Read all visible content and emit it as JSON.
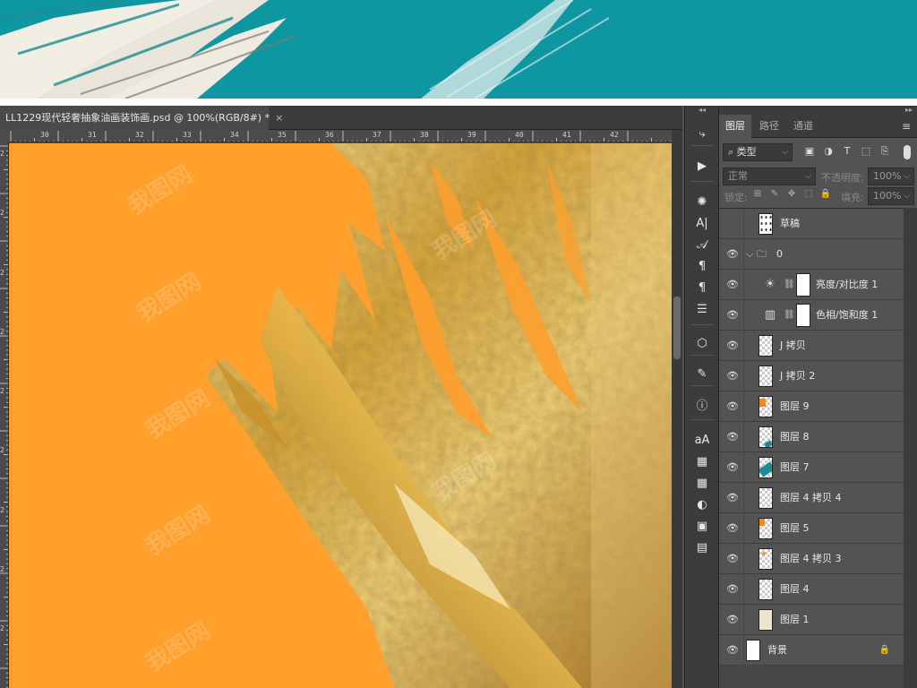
{
  "document": {
    "tab_title": "LL1229现代轻奢抽象油画装饰画.psd @ 100%(RGB/8#) *",
    "close_glyph": "×"
  },
  "ruler": {
    "h_labels": [
      "30",
      "31",
      "32",
      "33",
      "34",
      "35",
      "36",
      "37",
      "38",
      "39",
      "40",
      "41",
      "42"
    ],
    "v_labels": [
      "2",
      "2",
      "2",
      "2",
      "2",
      "2",
      "2",
      "2",
      "2"
    ],
    "corner_mark": "|"
  },
  "toolbar": {
    "collapse_glyph": "◂◂",
    "tools": [
      {
        "icon": "history-brush-icon",
        "glyph": "⤷"
      },
      {
        "icon": "play-icon",
        "glyph": "▶"
      },
      {
        "icon": "palette-icon",
        "glyph": "✺"
      },
      {
        "icon": "character-icon",
        "glyph": "A|"
      },
      {
        "icon": "glyph-icon",
        "glyph": "𝒜"
      },
      {
        "icon": "paragraph-styles-icon",
        "glyph": "¶"
      },
      {
        "icon": "paragraph-icon",
        "glyph": "¶"
      },
      {
        "icon": "properties-sliders-icon",
        "glyph": "☰"
      },
      {
        "icon": "3d-cube-icon",
        "glyph": "⬡"
      },
      {
        "icon": "brush-settings-icon",
        "glyph": "✎"
      },
      {
        "icon": "info-icon",
        "glyph": "ⓘ"
      },
      {
        "icon": "character-styles-icon",
        "glyph": "aA"
      },
      {
        "icon": "libraries-icon",
        "glyph": "▦"
      },
      {
        "icon": "swatches-icon",
        "glyph": "▦"
      },
      {
        "icon": "adjustments-icon",
        "glyph": "◐"
      },
      {
        "icon": "layer-comps-icon",
        "glyph": "▣"
      },
      {
        "icon": "notes-icon",
        "glyph": "▤"
      }
    ]
  },
  "panel": {
    "expand_glyph": "▸▸",
    "tabs": [
      "图层",
      "路径",
      "通道"
    ],
    "active_tab": "图层",
    "menu_glyph": "≡",
    "filter_label": "类型",
    "filter_icons": [
      "image-filter-icon",
      "adjustment-filter-icon",
      "type-filter-icon",
      "shape-filter-icon",
      "smart-object-filter-icon"
    ],
    "filter_glyphs": [
      "▣",
      "◑",
      "T",
      "⬚",
      "⎘"
    ],
    "blend_mode": "正常",
    "opacity_label": "不透明度:",
    "opacity_value": "100%",
    "lock_label": "锁定:",
    "lock_glyphs": [
      "⊞",
      "✎",
      "✥",
      "⬚",
      "🔒"
    ],
    "fill_label": "填充:",
    "fill_value": "100%",
    "search_glyph": "⌕",
    "caret_glyph": "⌵",
    "eye_glyph": "👁",
    "chain_glyph": "⛓",
    "group_caret_glyph": "⌵",
    "folder_glyph": "🗀",
    "lock_icon_glyph": "🔒",
    "layers": [
      {
        "name": "草稿",
        "visible": false,
        "kind": "pixel",
        "thumb": "sketch"
      },
      {
        "name": "0",
        "visible": true,
        "kind": "group"
      },
      {
        "name": "亮度/对比度 1",
        "visible": true,
        "kind": "adjustment",
        "adj_glyph": "☀"
      },
      {
        "name": "色相/饱和度 1",
        "visible": true,
        "kind": "adjustment",
        "adj_glyph": "▥"
      },
      {
        "name": "J 拷贝",
        "visible": true,
        "kind": "pixel",
        "thumb": "check"
      },
      {
        "name": "J 拷贝 2",
        "visible": true,
        "kind": "pixel",
        "thumb": "check"
      },
      {
        "name": "图层 9",
        "visible": true,
        "kind": "pixel",
        "thumb": "orange"
      },
      {
        "name": "图层 8",
        "visible": true,
        "kind": "pixel",
        "thumb": "teal-small"
      },
      {
        "name": "图层 7",
        "visible": true,
        "kind": "pixel",
        "thumb": "teal"
      },
      {
        "name": "图层 4 拷贝 4",
        "visible": true,
        "kind": "pixel",
        "thumb": "check"
      },
      {
        "name": "图层 5",
        "visible": true,
        "kind": "pixel",
        "thumb": "orange-top"
      },
      {
        "name": "图层 4 拷贝 3",
        "visible": true,
        "kind": "pixel",
        "thumb": "check-dots"
      },
      {
        "name": "图层 4",
        "visible": true,
        "kind": "pixel",
        "thumb": "check"
      },
      {
        "name": "图层 1",
        "visible": true,
        "kind": "pixel",
        "thumb": "cream"
      },
      {
        "name": "背景",
        "visible": true,
        "kind": "background",
        "thumb": "white",
        "locked": true
      }
    ]
  },
  "colors": {
    "banner_teal": "#0e97a0",
    "canvas_orange": "#ff9f2c",
    "gold_light": "#f7e08a",
    "gold_mid": "#d6a531",
    "gold_dark": "#8a5a12"
  },
  "watermark_text": "我图网"
}
